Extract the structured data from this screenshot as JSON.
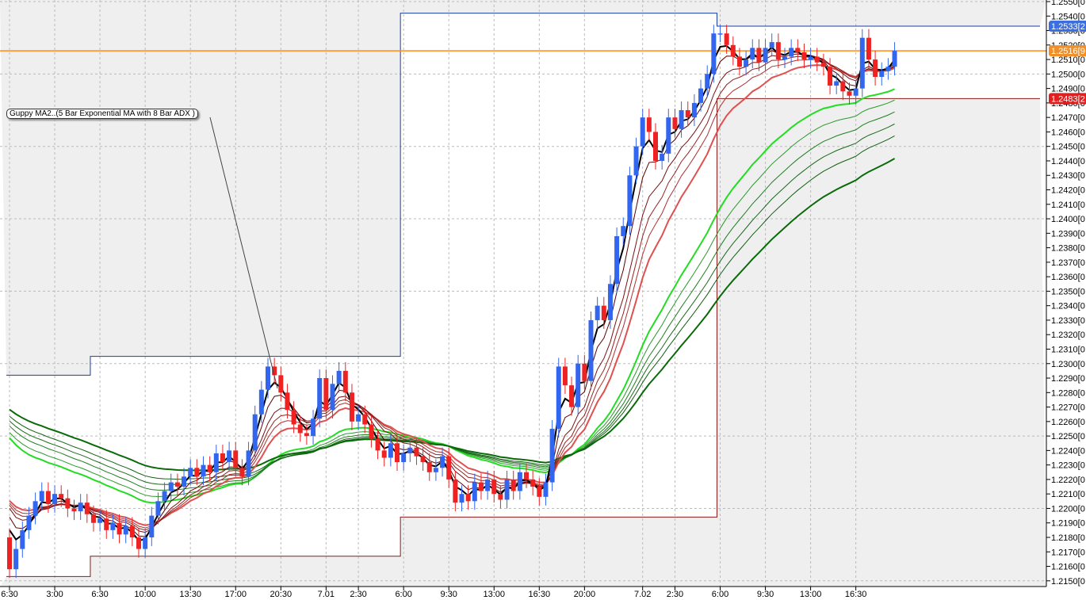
{
  "chart_data": {
    "type": "candlestick",
    "annotation": "Guppy MA2..(5 Bar Exponential MA with 8 Bar ADX )",
    "ylim": [
      1.215,
      1.255
    ],
    "y_ticks": [
      "1.2550[0",
      "1.2540[0",
      "1.2530[0",
      "1.2520[0",
      "1.2510[0",
      "1.2500[0",
      "1.2490[0",
      "1.2480[0",
      "1.2470[0",
      "1.2460[0",
      "1.2450[0",
      "1.2440[0",
      "1.2430[0",
      "1.2420[0",
      "1.2410[0",
      "1.2400[0",
      "1.2390[0",
      "1.2380[0",
      "1.2370[0",
      "1.2360[0",
      "1.2350[0",
      "1.2340[0",
      "1.2330[0",
      "1.2320[0",
      "1.2310[0",
      "1.2300[0",
      "1.2290[0",
      "1.2280[0",
      "1.2270[0",
      "1.2260[0",
      "1.2250[0",
      "1.2240[0",
      "1.2230[0",
      "1.2220[0",
      "1.2210[0",
      "1.2200[0",
      "1.2190[0",
      "1.2180[0",
      "1.2170[0",
      "1.2160[0",
      "1.2150[0"
    ],
    "x_ticks": [
      "6:30",
      "3:00",
      "6:30",
      "10:00",
      "13:30",
      "17:00",
      "20:30",
      "7.01",
      "2:30",
      "6:00",
      "9:30",
      "13:00",
      "16:30",
      "20:00",
      "7.02",
      "2:30",
      "6:00",
      "9:30",
      "13:00",
      "16:30"
    ],
    "x_tick_bars": [
      0,
      7,
      14,
      21,
      28,
      35,
      42,
      49,
      54,
      61,
      68,
      75,
      82,
      89,
      98,
      103,
      110,
      117,
      124,
      131
    ],
    "first_open": 1.218,
    "closes": [
      1.2158,
      1.2172,
      1.2185,
      1.2195,
      1.2205,
      1.2212,
      1.2203,
      1.221,
      1.2207,
      1.22,
      1.2198,
      1.2204,
      1.2196,
      1.219,
      1.2193,
      1.2185,
      1.219,
      1.2182,
      1.2188,
      1.218,
      1.2172,
      1.218,
      1.2195,
      1.2205,
      1.2212,
      1.2218,
      1.2215,
      1.2222,
      1.2228,
      1.2222,
      1.223,
      1.2225,
      1.2238,
      1.2232,
      1.224,
      1.2228,
      1.2222,
      1.224,
      1.2265,
      1.2282,
      1.2298,
      1.2292,
      1.228,
      1.2268,
      1.2258,
      1.2252,
      1.225,
      1.2262,
      1.229,
      1.2268,
      1.2286,
      1.2295,
      1.228,
      1.226,
      1.2265,
      1.2258,
      1.2248,
      1.224,
      1.2235,
      1.2245,
      1.2232,
      1.2238,
      1.2242,
      1.2236,
      1.2232,
      1.2225,
      1.2228,
      1.2236,
      1.222,
      1.2204,
      1.221,
      1.2205,
      1.2218,
      1.2212,
      1.222,
      1.221,
      1.2206,
      1.222,
      1.2212,
      1.2225,
      1.222,
      1.2215,
      1.2208,
      1.2218,
      1.2255,
      1.2298,
      1.2285,
      1.227,
      1.23,
      1.2288,
      1.233,
      1.234,
      1.233,
      1.2355,
      1.2388,
      1.2395,
      1.243,
      1.245,
      1.247,
      1.246,
      1.244,
      1.2445,
      1.247,
      1.2462,
      1.2475,
      1.247,
      1.248,
      1.249,
      1.25,
      1.2528,
      1.2528,
      1.252,
      1.2512,
      1.2505,
      1.251,
      1.2518,
      1.2508,
      1.2518,
      1.2522,
      1.251,
      1.2512,
      1.2518,
      1.2515,
      1.251,
      1.2512,
      1.2508,
      1.2505,
      1.2492,
      1.2495,
      1.2488,
      1.2485,
      1.249,
      1.2525,
      1.251,
      1.2498,
      1.2502,
      1.2505,
      1.2516
    ],
    "short_ema": {
      "periods": [
        3,
        5,
        8,
        10,
        12,
        15
      ],
      "seed": 1.2212,
      "colors": [
        "#000000",
        "#5a0000",
        "#7a1010",
        "#952020",
        "#b03030",
        "#e05050"
      ]
    },
    "long_ema": {
      "periods": [
        30,
        35,
        40,
        45,
        50,
        60
      ],
      "seeds": [
        1.2255,
        1.2258,
        1.2262,
        1.2265,
        1.2268,
        1.2272
      ],
      "colors": [
        "#22dd22",
        "#2a9a2a",
        "#1f7f1f",
        "#1a6a1a",
        "#126012",
        "#0a6a0a"
      ]
    },
    "day_high": [
      {
        "from": 0,
        "to": 13,
        "v": 1.2292
      },
      {
        "from": 13,
        "to": 61,
        "v": 1.2305
      },
      {
        "from": 61,
        "to": 110,
        "v": 1.2542
      },
      {
        "from": 110,
        "to": 160,
        "v": 1.2533
      }
    ],
    "day_low": [
      {
        "from": 0,
        "to": 13,
        "v": 1.2153
      },
      {
        "from": 13,
        "to": 61,
        "v": 1.2167
      },
      {
        "from": 61,
        "to": 110,
        "v": 1.2194
      },
      {
        "from": 110,
        "to": 160,
        "v": 1.2483
      }
    ],
    "price_tags": [
      {
        "label": "1.2533[2",
        "v": 1.2533,
        "color": "#3b6fe0"
      },
      {
        "label": "1.2516[9",
        "v": 1.2516,
        "color": "#f0902a"
      },
      {
        "label": "1.2483[2",
        "v": 1.2483,
        "color": "#e02020"
      }
    ],
    "last_price": 1.2516,
    "colors": {
      "up": "#3366ee",
      "down": "#ee2222",
      "high_line": "#1a3fa0",
      "low_line": "#8b1a1a",
      "last_line": "#ff8c1a",
      "shade": "#efefef"
    }
  }
}
